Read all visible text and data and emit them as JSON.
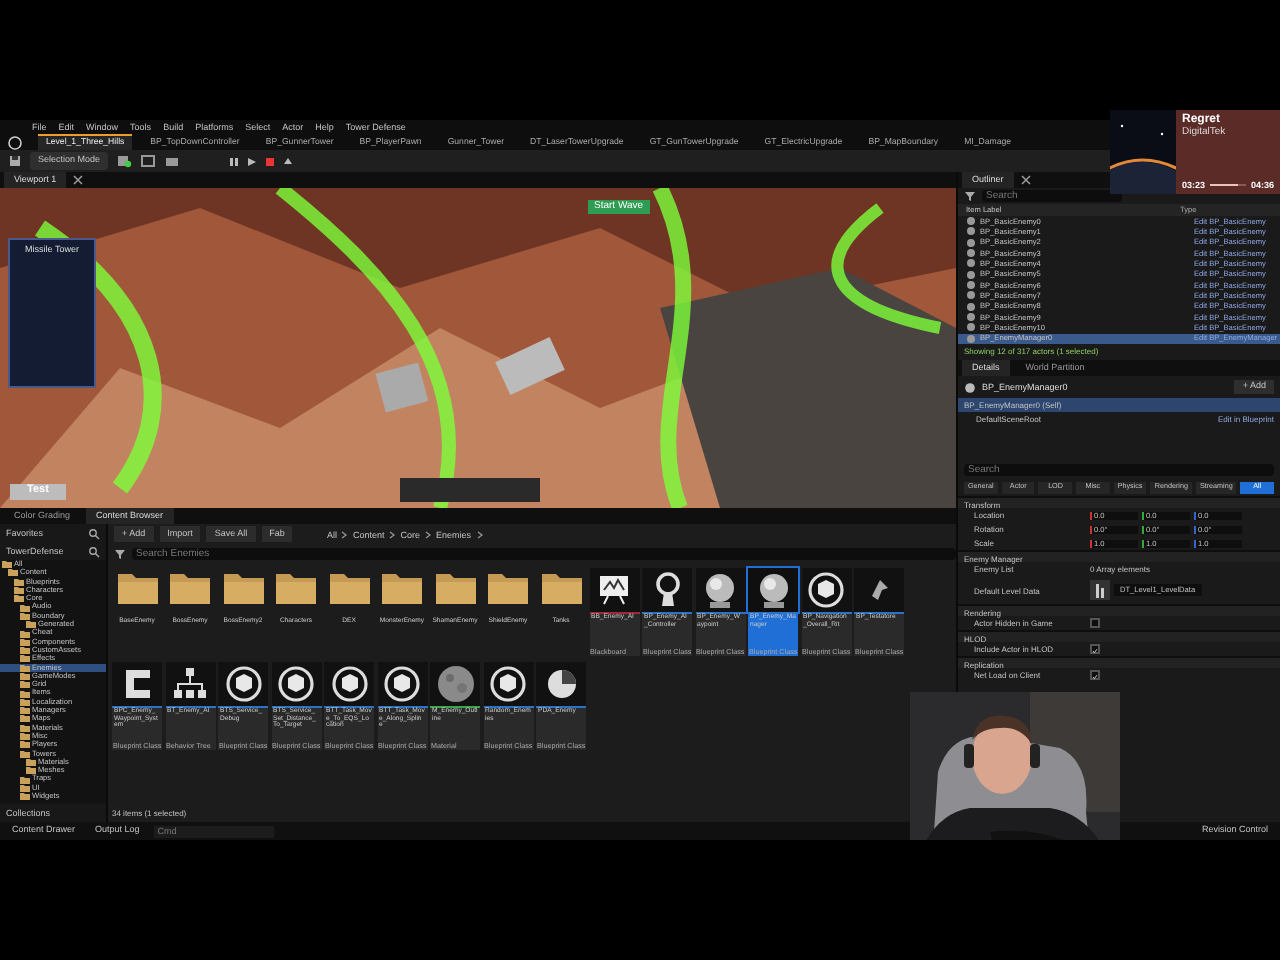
{
  "menu": [
    "File",
    "Edit",
    "Window",
    "Tools",
    "Build",
    "Platforms",
    "Select",
    "Actor",
    "Help",
    "Tower Defense"
  ],
  "doc_tabs": [
    {
      "label": "Level_1_Three_Hills",
      "selected": true
    },
    {
      "label": "BP_TopDownController",
      "selected": false
    },
    {
      "label": "BP_GunnerTower",
      "selected": false
    },
    {
      "label": "BP_PlayerPawn",
      "selected": false
    },
    {
      "label": "Gunner_Tower",
      "selected": false
    },
    {
      "label": "DT_LaserTowerUpgrade",
      "selected": false
    },
    {
      "label": "GT_GunTowerUpgrade",
      "selected": false
    },
    {
      "label": "GT_ElectricUpgrade",
      "selected": false
    },
    {
      "label": "BP_MapBoundary",
      "selected": false
    },
    {
      "label": "MI_Damage",
      "selected": false
    }
  ],
  "toolbar": {
    "mode": "Selection Mode"
  },
  "viewport": {
    "tab": "Viewport 1",
    "panel_title": "Missile Tower",
    "start_button": "Start Wave",
    "test_button": "Test"
  },
  "outliner": {
    "tab": "Outliner",
    "search_placeholder": "Search",
    "columns": [
      "Item Label",
      "Type"
    ],
    "rows": [
      {
        "label": "BP_BasicEnemy0",
        "type": "Edit BP_BasicEnemy",
        "selected": false
      },
      {
        "label": "BP_BasicEnemy1",
        "type": "Edit BP_BasicEnemy",
        "selected": false
      },
      {
        "label": "BP_BasicEnemy2",
        "type": "Edit BP_BasicEnemy",
        "selected": false
      },
      {
        "label": "BP_BasicEnemy3",
        "type": "Edit BP_BasicEnemy",
        "selected": false
      },
      {
        "label": "BP_BasicEnemy4",
        "type": "Edit BP_BasicEnemy",
        "selected": false
      },
      {
        "label": "BP_BasicEnemy5",
        "type": "Edit BP_BasicEnemy",
        "selected": false
      },
      {
        "label": "BP_BasicEnemy6",
        "type": "Edit BP_BasicEnemy",
        "selected": false
      },
      {
        "label": "BP_BasicEnemy7",
        "type": "Edit BP_BasicEnemy",
        "selected": false
      },
      {
        "label": "BP_BasicEnemy8",
        "type": "Edit BP_BasicEnemy",
        "selected": false
      },
      {
        "label": "BP_BasicEnemy9",
        "type": "Edit BP_BasicEnemy",
        "selected": false
      },
      {
        "label": "BP_BasicEnemy10",
        "type": "Edit BP_BasicEnemy",
        "selected": false
      },
      {
        "label": "BP_EnemyManager0",
        "type": "Edit BP_EnemyManager",
        "selected": true
      }
    ],
    "footer": "Showing 12 of 317 actors (1 selected)"
  },
  "details": {
    "tabs": [
      {
        "label": "Details",
        "selected": true
      },
      {
        "label": "World Partition",
        "selected": false
      }
    ],
    "actor": "BP_EnemyManager0",
    "add_button": "+ Add",
    "components": [
      {
        "label": "BP_EnemyManager0 (Self)",
        "selected": true
      },
      {
        "label": "DefaultSceneRoot",
        "selected": false
      }
    ],
    "edit_link": "Edit in Blueprint",
    "search_placeholder": "Search",
    "filters": [
      {
        "label": "General",
        "selected": false
      },
      {
        "label": "Actor",
        "selected": false
      },
      {
        "label": "LOD",
        "selected": false
      },
      {
        "label": "Misc",
        "selected": false
      },
      {
        "label": "Physics",
        "selected": false
      },
      {
        "label": "Rendering",
        "selected": false
      },
      {
        "label": "Streaming",
        "selected": false
      },
      {
        "label": "All",
        "selected": true
      }
    ],
    "sections": [
      {
        "title": "Transform",
        "rows": [
          {
            "kind": "vector",
            "label": "Location",
            "values": [
              "0.0",
              "0.0",
              "0.0"
            ]
          },
          {
            "kind": "vector",
            "label": "Rotation",
            "values": [
              "0.0°",
              "0.0°",
              "0.0°"
            ]
          },
          {
            "kind": "vector",
            "label": "Scale",
            "values": [
              "1.0",
              "1.0",
              "1.0"
            ]
          }
        ]
      },
      {
        "title": "Enemy Manager",
        "rows": [
          {
            "kind": "text",
            "label": "Enemy List",
            "value": "0 Array elements"
          },
          {
            "kind": "asset",
            "label": "Default Level Data",
            "value": "DT_Level1_LevelData"
          }
        ]
      },
      {
        "title": "Rendering",
        "rows": [
          {
            "kind": "check",
            "label": "Actor Hidden in Game",
            "checked": false
          }
        ]
      },
      {
        "title": "HLOD",
        "rows": [
          {
            "kind": "check",
            "label": "Include Actor in HLOD",
            "checked": true
          }
        ]
      },
      {
        "title": "Replication",
        "rows": [
          {
            "kind": "check",
            "label": "Net Load on Client",
            "checked": true
          }
        ]
      }
    ]
  },
  "content_browser": {
    "tabs": [
      {
        "label": "Color Grading",
        "selected": false
      },
      {
        "label": "Content Browser",
        "selected": true
      }
    ],
    "favorites": "Favorites",
    "project": "TowerDefense",
    "collections": "Collections",
    "tree": [
      {
        "label": "All",
        "selected": false,
        "children": [
          {
            "label": "Content",
            "selected": false,
            "children": [
              {
                "label": "Blueprints",
                "selected": false
              },
              {
                "label": "Characters",
                "selected": false
              },
              {
                "label": "Core",
                "selected": false,
                "children": [
                  {
                    "label": "Audio",
                    "selected": false
                  },
                  {
                    "label": "Boundary",
                    "selected": false,
                    "children": [
                      {
                        "label": "Generated",
                        "selected": false
                      }
                    ]
                  },
                  {
                    "label": "Cheat",
                    "selected": false
                  },
                  {
                    "label": "Components",
                    "selected": false
                  },
                  {
                    "label": "CustomAssets",
                    "selected": false
                  },
                  {
                    "label": "Effects",
                    "selected": false
                  },
                  {
                    "label": "Enemies",
                    "selected": true
                  },
                  {
                    "label": "GameModes",
                    "selected": false
                  },
                  {
                    "label": "Grid",
                    "selected": false
                  },
                  {
                    "label": "Items",
                    "selected": false
                  },
                  {
                    "label": "Localization",
                    "selected": false
                  },
                  {
                    "label": "Managers",
                    "selected": false
                  },
                  {
                    "label": "Maps",
                    "selected": false
                  },
                  {
                    "label": "Materials",
                    "selected": false
                  },
                  {
                    "label": "Misc",
                    "selected": false
                  },
                  {
                    "label": "Players",
                    "selected": false
                  },
                  {
                    "label": "Towers",
                    "selected": false,
                    "children": [
                      {
                        "label": "Materials",
                        "selected": false
                      },
                      {
                        "label": "Meshes",
                        "selected": false
                      }
                    ]
                  },
                  {
                    "label": "Traps",
                    "selected": false
                  },
                  {
                    "label": "UI",
                    "selected": false
                  },
                  {
                    "label": "Widgets",
                    "selected": false
                  }
                ]
              }
            ]
          }
        ]
      }
    ],
    "buttons": [
      "+ Add",
      "Import",
      "Save All",
      "Fab"
    ],
    "path": [
      "All",
      "Content",
      "Core",
      "Enemies"
    ],
    "search_placeholder": "Search Enemies",
    "assets": [
      {
        "kind": "folder",
        "name": "BaseEnemy"
      },
      {
        "kind": "folder",
        "name": "BossEnemy"
      },
      {
        "kind": "folder",
        "name": "BossEnemy2"
      },
      {
        "kind": "folder",
        "name": "Characters"
      },
      {
        "kind": "folder",
        "name": "DEX"
      },
      {
        "kind": "folder",
        "name": "MonsterEnemy"
      },
      {
        "kind": "folder",
        "name": "ShamanEnemy"
      },
      {
        "kind": "folder",
        "name": "ShieldEnemy"
      },
      {
        "kind": "folder",
        "name": "Tanks"
      },
      {
        "kind": "blackboard",
        "name": "BB_Enemy_AI",
        "type": "Blackboard",
        "color": "#a02a3a",
        "selected": false
      },
      {
        "kind": "controller",
        "name": "BP_Enemy_AI_Controller",
        "type": "Blueprint Class",
        "color": "#2a74c8",
        "selected": false
      },
      {
        "kind": "sphere",
        "name": "BP_Enemy_Waypoint",
        "type": "Blueprint Class",
        "color": "#2a74c8",
        "selected": false
      },
      {
        "kind": "sphere",
        "name": "BP_Enemy_Manager",
        "type": "Blueprint Class",
        "color": "#2a74c8",
        "selected": true
      },
      {
        "kind": "cube",
        "name": "BP_Navigation_Overall_Rit",
        "type": "Blueprint Class",
        "color": "#2a74c8",
        "selected": false
      },
      {
        "kind": "ship",
        "name": "BP_Testatore",
        "type": "Blueprint Class",
        "color": "#2a74c8",
        "selected": false
      },
      {
        "kind": "bracket",
        "name": "BPC_Enemy_Waypoint_System",
        "type": "Blueprint Class",
        "color": "#2a74c8",
        "selected": false
      },
      {
        "kind": "tree",
        "name": "BT_Enemy_AI",
        "type": "Behavior Tree",
        "color": "#2a74c8",
        "selected": false
      },
      {
        "kind": "cube",
        "name": "BTS_Service_Debug",
        "type": "Blueprint Class",
        "color": "#2a74c8",
        "selected": false
      },
      {
        "kind": "cube",
        "name": "BTS_Service_Set_Distance_To_Target",
        "type": "Blueprint Class",
        "color": "#2a74c8",
        "selected": false
      },
      {
        "kind": "cube",
        "name": "BTT_Task_Move_To_EQS_Location",
        "type": "Blueprint Class",
        "color": "#2a74c8",
        "selected": false
      },
      {
        "kind": "cube",
        "name": "BTT_Task_Move_Along_Spline",
        "type": "Blueprint Class",
        "color": "#2a74c8",
        "selected": false
      },
      {
        "kind": "moon",
        "name": "M_Enemy_Outline",
        "type": "Material",
        "color": "#3aa64a",
        "selected": false
      },
      {
        "kind": "cube",
        "name": "Random_Enemies",
        "type": "Blueprint Class",
        "color": "#2a74c8",
        "selected": false
      },
      {
        "kind": "pie",
        "name": "PDA_Enemy",
        "type": "Blueprint Class",
        "color": "#2a74c8",
        "selected": false
      }
    ],
    "footer": "34 items (1 selected)"
  },
  "status_bar": {
    "content_drawer": "Content Drawer",
    "output_log": "Output Log",
    "cmd_placeholder": "Cmd",
    "revision": "Revision Control"
  },
  "now_playing": {
    "title": "Regret",
    "artist": "DigitalTek",
    "elapsed": "03:23",
    "total": "04:36",
    "level": 0.74
  }
}
